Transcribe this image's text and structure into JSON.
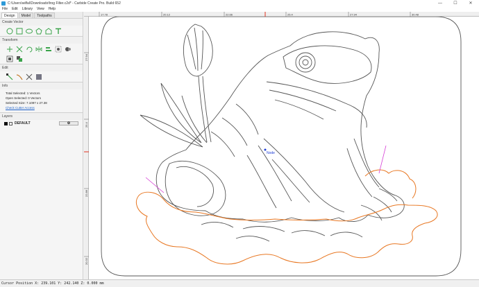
{
  "window": {
    "title": "C:\\Users\\wilfal\\Downloads\\frog Filter.c2d* - Carbide Create Pro. Build 652",
    "minimize": "—",
    "maximize": "☐",
    "close": "✕"
  },
  "menu": [
    "File",
    "Edit",
    "Library",
    "View",
    "Help"
  ],
  "tabs": [
    "Design",
    "Model",
    "Toolpaths"
  ],
  "sections": {
    "create_vector": "Create Vector",
    "transform": "Transform",
    "edit": "Edit",
    "info": "Info",
    "layers": "Layers"
  },
  "info": {
    "total_selected": "Total Selected:  1 Vectors",
    "open_selected": "Open Selected:  0 Vectors",
    "selected_size": "Selected Size:   7.1097 x 27.38",
    "check_cutter": "Check Cutter Access"
  },
  "layers": [
    {
      "name": "DEFAULT",
      "color": "#111111",
      "button": "⚙"
    }
  ],
  "hruler_ticks": [
    "17.78",
    "20.12",
    "22.66",
    "25.4",
    "27.94",
    "30.48"
  ],
  "vruler_ticks": [
    "27.94",
    "25.4",
    "22.86",
    "20.32"
  ],
  "canvas": {
    "node_label": "Node",
    "selected_color": "#e87722",
    "outline_color": "#555555",
    "node_color": "#1f3fd6",
    "handle_color": "#d63ad6"
  },
  "status": "Cursor Position X: 239.101 Y: 242.140 Z: 0.000 mm"
}
